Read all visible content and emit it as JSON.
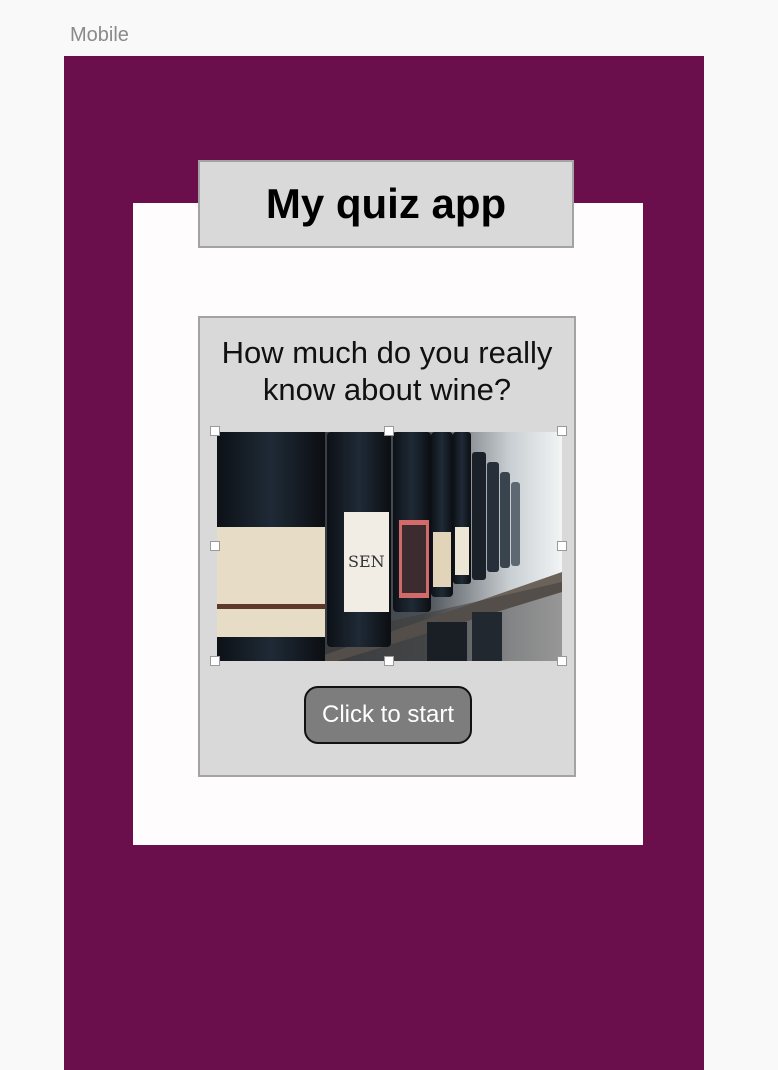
{
  "frame": {
    "label": "Mobile"
  },
  "app": {
    "title": "My quiz app",
    "question": "How much do you really know about wine?",
    "start_button_label": "Click to start"
  },
  "image": {
    "label_text": "SEN"
  },
  "colors": {
    "artboard": "#6b0f4c",
    "card": "#fffcfd",
    "box": "#d9d9d9",
    "button": "#7d7d7d"
  }
}
